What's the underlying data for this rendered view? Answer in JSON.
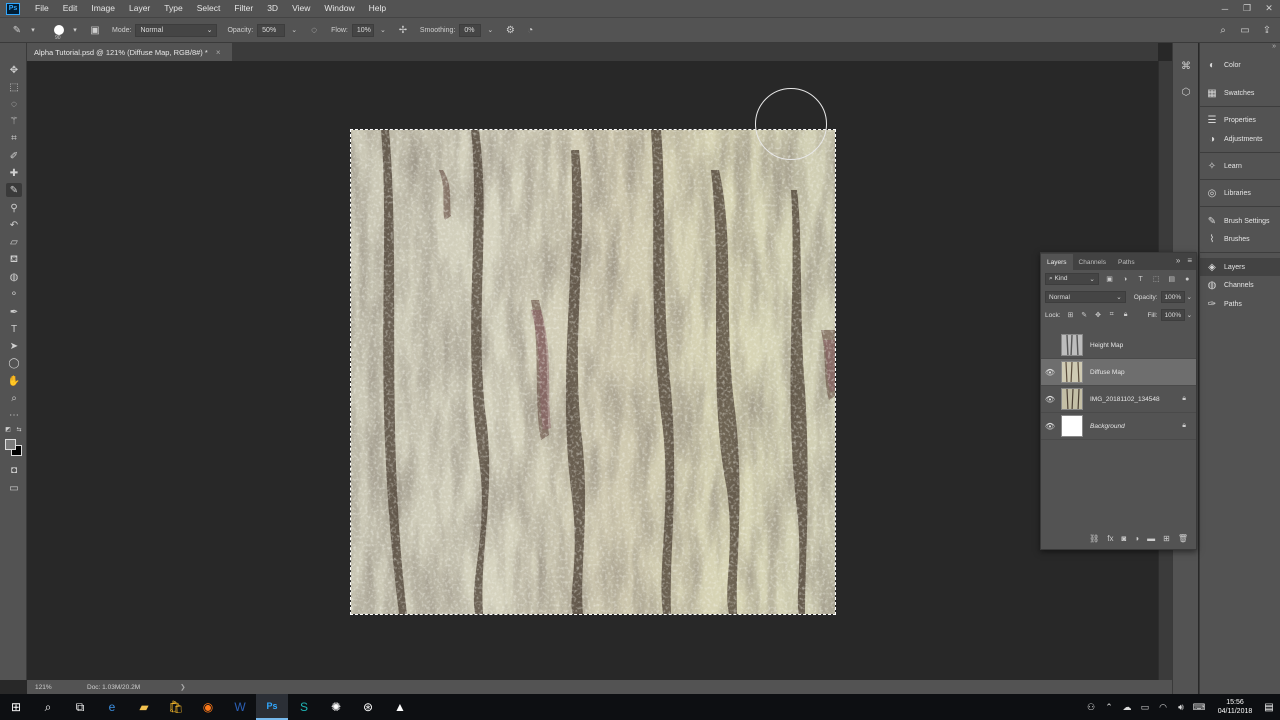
{
  "app": {
    "logo": "Ps",
    "menu": [
      "File",
      "Edit",
      "Image",
      "Layer",
      "Type",
      "Select",
      "Filter",
      "3D",
      "View",
      "Window",
      "Help"
    ]
  },
  "options": {
    "brush_size": "90",
    "mode_label": "Mode:",
    "mode_value": "Normal",
    "opacity_label": "Opacity:",
    "opacity_value": "50%",
    "flow_label": "Flow:",
    "flow_value": "10%",
    "smoothing_label": "Smoothing:",
    "smoothing_value": "0%"
  },
  "document": {
    "tab_title": "Alpha Tutorial.psd @ 121% (Diffuse Map, RGB/8#) *",
    "close": "×"
  },
  "status": {
    "zoom": "121%",
    "doc_info": "Doc: 1.03M/20.2M",
    "arrow": "❯"
  },
  "panels": [
    {
      "label": "Color",
      "icon": "color-icon",
      "glyph": "◐"
    },
    {
      "label": "Swatches",
      "icon": "swatches-icon",
      "glyph": "▦"
    },
    {
      "label": "Properties",
      "icon": "properties-icon",
      "glyph": "☰"
    },
    {
      "label": "Adjustments",
      "icon": "adjustments-icon",
      "glyph": "◑"
    },
    {
      "label": "Learn",
      "icon": "learn-icon",
      "glyph": "✧"
    },
    {
      "label": "Libraries",
      "icon": "libraries-icon",
      "glyph": "◎"
    },
    {
      "label": "Brush Settings",
      "icon": "brush-settings-icon",
      "glyph": "✎"
    },
    {
      "label": "Brushes",
      "icon": "brushes-icon",
      "glyph": "⌇"
    },
    {
      "label": "Layers",
      "icon": "layers-icon",
      "glyph": "◈"
    },
    {
      "label": "Channels",
      "icon": "channels-icon",
      "glyph": "◍"
    },
    {
      "label": "Paths",
      "icon": "paths-icon",
      "glyph": "✑"
    }
  ],
  "layers_panel": {
    "tabs": [
      "Layers",
      "Channels",
      "Paths"
    ],
    "filter_label": "Kind",
    "blend_mode": "Normal",
    "opacity_label": "Opacity:",
    "opacity_value": "100%",
    "lock_label": "Lock:",
    "fill_label": "Fill:",
    "fill_value": "100%",
    "layers": [
      {
        "name": "Height Map",
        "visible": false,
        "selected": false,
        "locked": false,
        "italic": false
      },
      {
        "name": "Diffuse Map",
        "visible": true,
        "selected": true,
        "locked": false,
        "italic": false
      },
      {
        "name": "IMG_20181102_134548",
        "visible": true,
        "selected": false,
        "locked": true,
        "italic": false
      },
      {
        "name": "Background",
        "visible": true,
        "selected": false,
        "locked": true,
        "italic": true
      }
    ]
  },
  "taskbar": {
    "time": "15:56",
    "date": "04/11/2018"
  },
  "colors": {
    "accent": "#31a8ff",
    "ui_bg": "#535353",
    "canvas_bg": "#282828",
    "taskbar_bg": "#0d0f12"
  }
}
